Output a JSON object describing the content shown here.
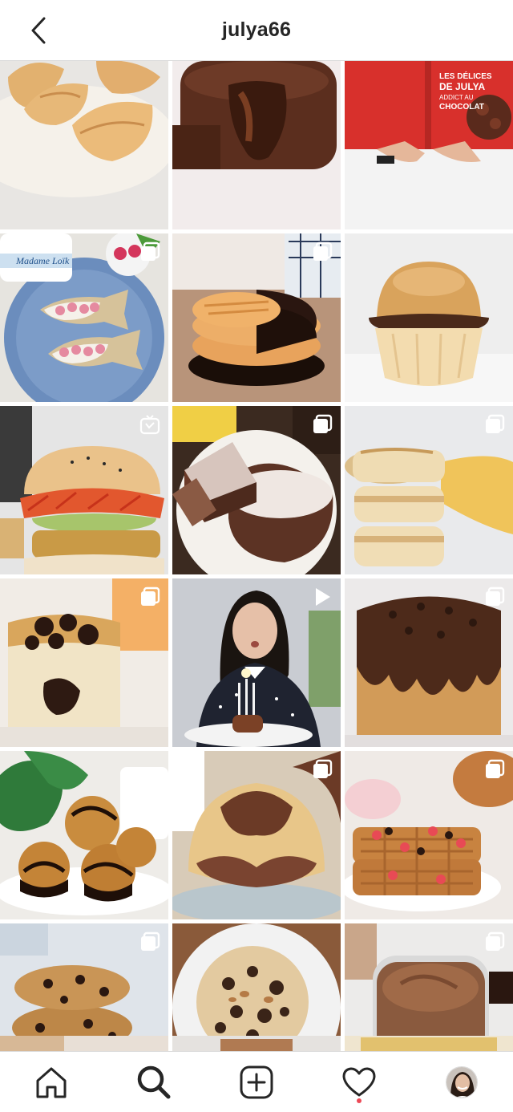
{
  "header": {
    "username": "julya66"
  },
  "book_cover": {
    "line1": "LES DÉLICES",
    "line2": "DE JULYA",
    "line3": "ADDICT AU",
    "line4": "CHOCOLAT"
  },
  "madame_loik_label": "Madame Loïk",
  "grid": {
    "posts": [
      {
        "subject": "croissants",
        "badge": "none"
      },
      {
        "subject": "chocolate lava cake",
        "badge": "none"
      },
      {
        "subject": "cookbook",
        "badge": "none"
      },
      {
        "subject": "fish radish toasts",
        "badge": "carousel"
      },
      {
        "subject": "chocolate dipped cookies",
        "badge": "carousel"
      },
      {
        "subject": "chocolate filled brioche",
        "badge": "none"
      },
      {
        "subject": "veggie burger",
        "badge": "igtv"
      },
      {
        "subject": "chocolate cake",
        "badge": "carousel"
      },
      {
        "subject": "scones",
        "badge": "carousel"
      },
      {
        "subject": "chocolate chip loaf",
        "badge": "carousel"
      },
      {
        "subject": "birthday video",
        "badge": "video"
      },
      {
        "subject": "chocolate glazed cake",
        "badge": "carousel"
      },
      {
        "subject": "coconut rochers",
        "badge": "none"
      },
      {
        "subject": "marble madeleine",
        "badge": "carousel"
      },
      {
        "subject": "waffles",
        "badge": "carousel"
      },
      {
        "subject": "oat cookies stack",
        "badge": "carousel"
      },
      {
        "subject": "giant cookie",
        "badge": "none"
      },
      {
        "subject": "chocolate mousse jar",
        "badge": "carousel"
      }
    ]
  },
  "tabbar": {
    "items": [
      "home",
      "search",
      "new-post",
      "activity",
      "profile"
    ],
    "active": "search",
    "notification_color": "#ed4956"
  }
}
